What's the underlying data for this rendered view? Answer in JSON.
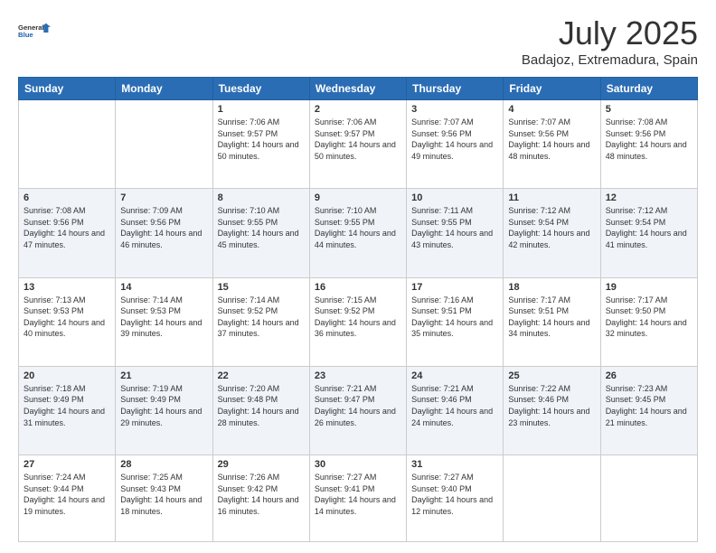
{
  "logo": {
    "line1": "General",
    "line2": "Blue"
  },
  "title": "July 2025",
  "subtitle": "Badajoz, Extremadura, Spain",
  "weekdays": [
    "Sunday",
    "Monday",
    "Tuesday",
    "Wednesday",
    "Thursday",
    "Friday",
    "Saturday"
  ],
  "weeks": [
    [
      {
        "day": "",
        "info": ""
      },
      {
        "day": "",
        "info": ""
      },
      {
        "day": "1",
        "info": "Sunrise: 7:06 AM\nSunset: 9:57 PM\nDaylight: 14 hours and 50 minutes."
      },
      {
        "day": "2",
        "info": "Sunrise: 7:06 AM\nSunset: 9:57 PM\nDaylight: 14 hours and 50 minutes."
      },
      {
        "day": "3",
        "info": "Sunrise: 7:07 AM\nSunset: 9:56 PM\nDaylight: 14 hours and 49 minutes."
      },
      {
        "day": "4",
        "info": "Sunrise: 7:07 AM\nSunset: 9:56 PM\nDaylight: 14 hours and 48 minutes."
      },
      {
        "day": "5",
        "info": "Sunrise: 7:08 AM\nSunset: 9:56 PM\nDaylight: 14 hours and 48 minutes."
      }
    ],
    [
      {
        "day": "6",
        "info": "Sunrise: 7:08 AM\nSunset: 9:56 PM\nDaylight: 14 hours and 47 minutes."
      },
      {
        "day": "7",
        "info": "Sunrise: 7:09 AM\nSunset: 9:56 PM\nDaylight: 14 hours and 46 minutes."
      },
      {
        "day": "8",
        "info": "Sunrise: 7:10 AM\nSunset: 9:55 PM\nDaylight: 14 hours and 45 minutes."
      },
      {
        "day": "9",
        "info": "Sunrise: 7:10 AM\nSunset: 9:55 PM\nDaylight: 14 hours and 44 minutes."
      },
      {
        "day": "10",
        "info": "Sunrise: 7:11 AM\nSunset: 9:55 PM\nDaylight: 14 hours and 43 minutes."
      },
      {
        "day": "11",
        "info": "Sunrise: 7:12 AM\nSunset: 9:54 PM\nDaylight: 14 hours and 42 minutes."
      },
      {
        "day": "12",
        "info": "Sunrise: 7:12 AM\nSunset: 9:54 PM\nDaylight: 14 hours and 41 minutes."
      }
    ],
    [
      {
        "day": "13",
        "info": "Sunrise: 7:13 AM\nSunset: 9:53 PM\nDaylight: 14 hours and 40 minutes."
      },
      {
        "day": "14",
        "info": "Sunrise: 7:14 AM\nSunset: 9:53 PM\nDaylight: 14 hours and 39 minutes."
      },
      {
        "day": "15",
        "info": "Sunrise: 7:14 AM\nSunset: 9:52 PM\nDaylight: 14 hours and 37 minutes."
      },
      {
        "day": "16",
        "info": "Sunrise: 7:15 AM\nSunset: 9:52 PM\nDaylight: 14 hours and 36 minutes."
      },
      {
        "day": "17",
        "info": "Sunrise: 7:16 AM\nSunset: 9:51 PM\nDaylight: 14 hours and 35 minutes."
      },
      {
        "day": "18",
        "info": "Sunrise: 7:17 AM\nSunset: 9:51 PM\nDaylight: 14 hours and 34 minutes."
      },
      {
        "day": "19",
        "info": "Sunrise: 7:17 AM\nSunset: 9:50 PM\nDaylight: 14 hours and 32 minutes."
      }
    ],
    [
      {
        "day": "20",
        "info": "Sunrise: 7:18 AM\nSunset: 9:49 PM\nDaylight: 14 hours and 31 minutes."
      },
      {
        "day": "21",
        "info": "Sunrise: 7:19 AM\nSunset: 9:49 PM\nDaylight: 14 hours and 29 minutes."
      },
      {
        "day": "22",
        "info": "Sunrise: 7:20 AM\nSunset: 9:48 PM\nDaylight: 14 hours and 28 minutes."
      },
      {
        "day": "23",
        "info": "Sunrise: 7:21 AM\nSunset: 9:47 PM\nDaylight: 14 hours and 26 minutes."
      },
      {
        "day": "24",
        "info": "Sunrise: 7:21 AM\nSunset: 9:46 PM\nDaylight: 14 hours and 24 minutes."
      },
      {
        "day": "25",
        "info": "Sunrise: 7:22 AM\nSunset: 9:46 PM\nDaylight: 14 hours and 23 minutes."
      },
      {
        "day": "26",
        "info": "Sunrise: 7:23 AM\nSunset: 9:45 PM\nDaylight: 14 hours and 21 minutes."
      }
    ],
    [
      {
        "day": "27",
        "info": "Sunrise: 7:24 AM\nSunset: 9:44 PM\nDaylight: 14 hours and 19 minutes."
      },
      {
        "day": "28",
        "info": "Sunrise: 7:25 AM\nSunset: 9:43 PM\nDaylight: 14 hours and 18 minutes."
      },
      {
        "day": "29",
        "info": "Sunrise: 7:26 AM\nSunset: 9:42 PM\nDaylight: 14 hours and 16 minutes."
      },
      {
        "day": "30",
        "info": "Sunrise: 7:27 AM\nSunset: 9:41 PM\nDaylight: 14 hours and 14 minutes."
      },
      {
        "day": "31",
        "info": "Sunrise: 7:27 AM\nSunset: 9:40 PM\nDaylight: 14 hours and 12 minutes."
      },
      {
        "day": "",
        "info": ""
      },
      {
        "day": "",
        "info": ""
      }
    ]
  ]
}
